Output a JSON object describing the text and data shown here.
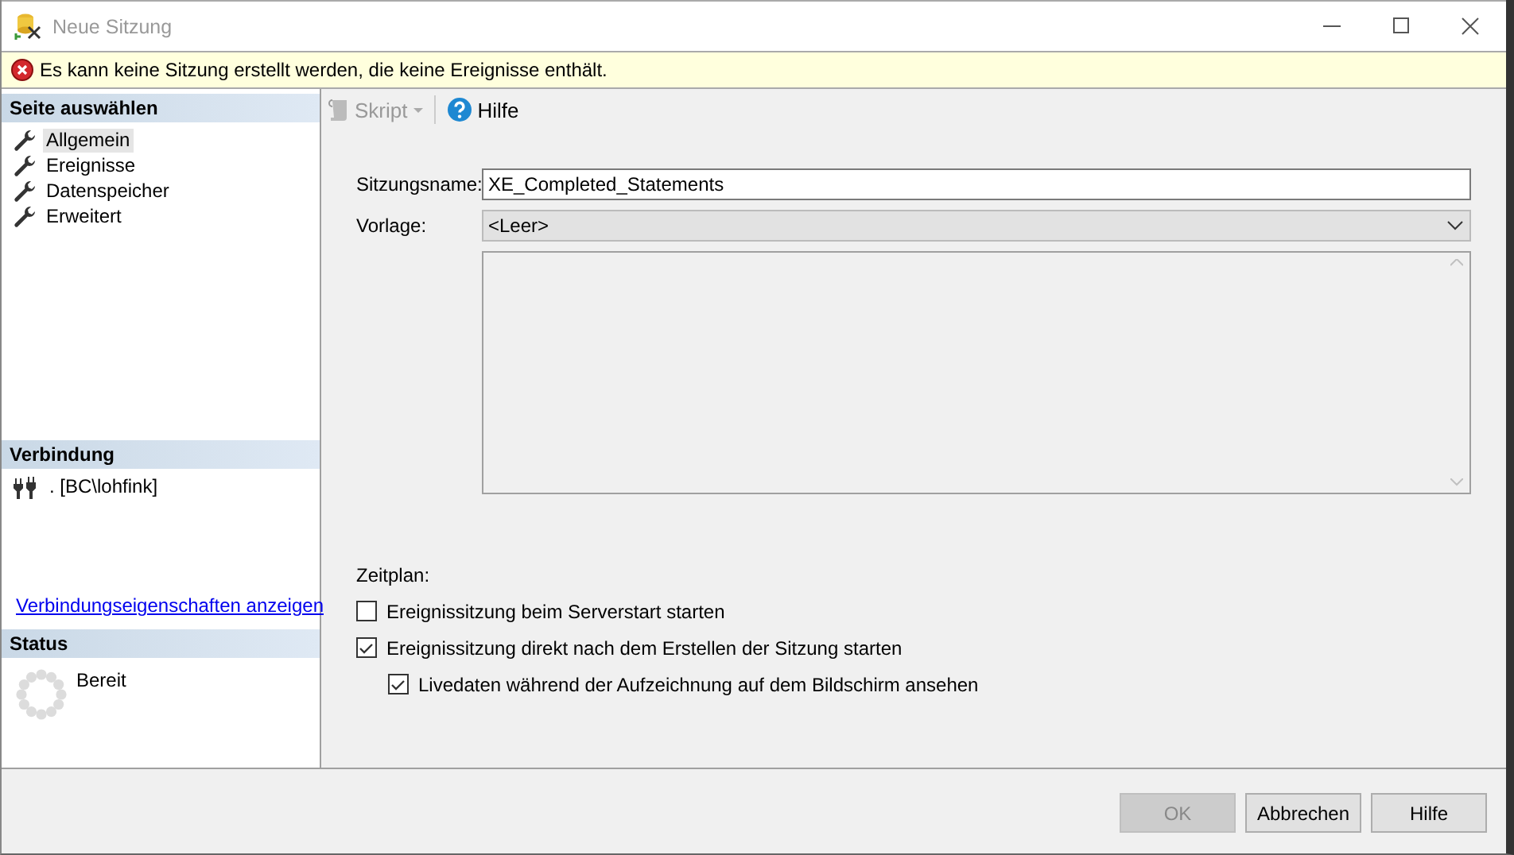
{
  "window": {
    "title": "Neue Sitzung"
  },
  "error": {
    "message": "Es kann keine Sitzung erstellt werden, die keine Ereignisse enthält."
  },
  "sidebar": {
    "title": "Seite auswählen",
    "items": [
      {
        "label": "Allgemein",
        "selected": true
      },
      {
        "label": "Ereignisse",
        "selected": false
      },
      {
        "label": "Datenspeicher",
        "selected": false
      },
      {
        "label": "Erweitert",
        "selected": false
      }
    ]
  },
  "connection": {
    "title": "Verbindung",
    "server": ". [BC\\lohfink]",
    "link": "Verbindungseigenschaften anzeigen"
  },
  "status": {
    "title": "Status",
    "text": "Bereit"
  },
  "toolbar": {
    "items": [
      {
        "kind": "script",
        "label": "Skript",
        "disabled": true
      },
      {
        "kind": "help",
        "label": "Hilfe",
        "disabled": false
      }
    ]
  },
  "form": {
    "session_name_label": "Sitzungsname:",
    "session_name": "XE_Completed_Statements",
    "template_label": "Vorlage:",
    "template": "<Leer>",
    "schedule_label": "Zeitplan:",
    "options": [
      {
        "label": "Ereignissitzung beim Serverstart starten",
        "checked": false
      },
      {
        "label": "Ereignissitzung direkt nach dem Erstellen der Sitzung starten",
        "checked": true,
        "children": [
          {
            "label": "Livedaten während der Aufzeichnung auf dem Bildschirm ansehen",
            "checked": true
          }
        ]
      }
    ]
  },
  "buttons": [
    {
      "label": "OK",
      "disabled": true
    },
    {
      "label": "Abbrechen",
      "disabled": false
    },
    {
      "label": "Hilfe",
      "disabled": false
    }
  ]
}
